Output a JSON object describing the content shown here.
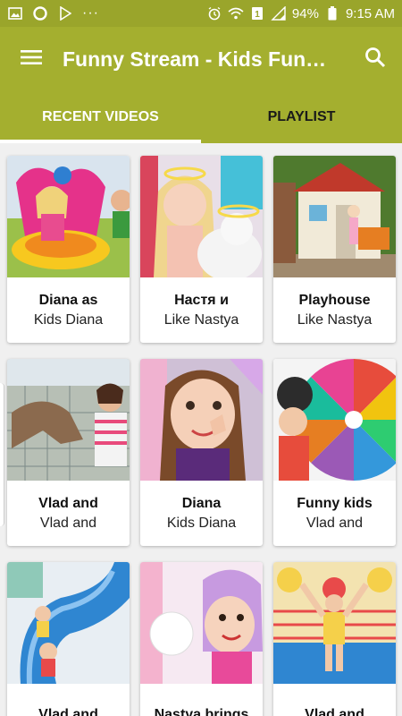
{
  "status_bar": {
    "battery": "94%",
    "time": "9:15 AM",
    "dots": "···"
  },
  "app_bar": {
    "title": "Funny Stream - Kids Fun…"
  },
  "tabs": [
    {
      "label": "RECENT VIDEOS",
      "active": true
    },
    {
      "label": "PLAYLIST",
      "active": false
    }
  ],
  "videos": [
    {
      "title": "Diana as",
      "subtitle": "Kids Diana"
    },
    {
      "title": "Настя и",
      "subtitle": "Like Nastya"
    },
    {
      "title": "Playhouse",
      "subtitle": "Like Nastya"
    },
    {
      "title": "Vlad and",
      "subtitle": "Vlad and"
    },
    {
      "title": "Diana",
      "subtitle": "Kids Diana"
    },
    {
      "title": "Funny kids",
      "subtitle": "Vlad and"
    },
    {
      "title": "Vlad and",
      "subtitle": ""
    },
    {
      "title": "Nastya brings",
      "subtitle": ""
    },
    {
      "title": "Vlad and",
      "subtitle": ""
    }
  ],
  "colors": {
    "primary": "#a4af2f",
    "status": "#9aa52b"
  },
  "icons": [
    "image-icon",
    "opera-icon",
    "play-store-icon",
    "alarm-icon",
    "wifi-icon",
    "signal-icon",
    "battery-icon",
    "menu-icon",
    "search-icon"
  ]
}
